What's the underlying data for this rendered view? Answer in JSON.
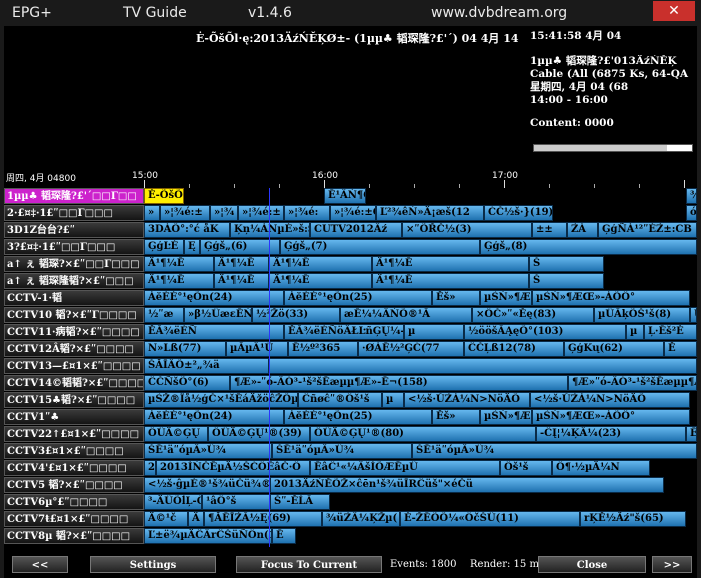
{
  "titlebar": {
    "app_name": "EPG+",
    "view": "TV Guide",
    "version": "v1.4.6",
    "website": "www.dvbdream.org",
    "close_glyph": "✕"
  },
  "info": {
    "description": "Ė-ÕšÕl·ę:2013ÄźŃĚĶØ±- (1µµ♣ 韬琛隆?£'´) 04 4月 14",
    "clock": "15:41:58  4月 04",
    "channel_name": "1µµ♣ 韬琛隆?£'013ÄźŃĚĶ",
    "cable": "Cable (All (6875 Ks, 64-QA",
    "weekday_date": "星期四, 4月 04 (68",
    "time_range": "14:00 - 16:00",
    "content_label": "Content: 0000",
    "progress_fraction": 0.84
  },
  "timeline": {
    "date_label": "周四, 4月 04800",
    "ticks": [
      "15:00",
      "16:00",
      "17:00"
    ]
  },
  "channels": [
    {
      "name": "1µµ♣ 韬琛隆?£'´□□Γ□□",
      "selected": true,
      "programs": [
        {
          "title": "Ė-ÕšÕl·ę:2013ÄźŃĚĶØ±-",
          "now": true
        },
        {
          "title": "Ē¹ÂŃ¶Ô≥¹:2010ÄźÂŃÌRÖ°NµŃ²»ÚČü"
        },
        {
          "title": "¾"
        }
      ]
    },
    {
      "name": "2·£¤‡·1£ʺ□□Γ□□□",
      "programs": [
        {
          "title": "»"
        },
        {
          "title": "»¦¾é:±"
        },
        {
          "title": "»¦¾"
        },
        {
          "title": "»¦¾é:±"
        },
        {
          "title": "»¦¾é:"
        },
        {
          "title": "»¦¾é:±GĀ"
        },
        {
          "title": "Ľ²¾êŃ»Ä¡æš(12"
        },
        {
          "title": "ĆČ½š·}(19)"
        },
        {
          "title": "ó"
        }
      ]
    },
    {
      "name": "3D1Z台台?£ʺ",
      "programs": [
        {
          "title": "3DÁÕ°:°ć åK"
        },
        {
          "title": "Ķņ¼ÀNµÉ»š:Š"
        },
        {
          "title": "CUTV2012Âź"
        },
        {
          "title": "×ʺÕŘČ½(3)"
        },
        {
          "title": "±±"
        },
        {
          "title": "ŹÁ"
        },
        {
          "title": "ĢģÑÁ¹²ʺÉŹ±:CB"
        }
      ]
    },
    {
      "name": "3?£¤‡·1£ʺ□□Γ□□□",
      "programs": [
        {
          "title": "ĢģĿÉ"
        },
        {
          "title": "Ę"
        },
        {
          "title": "Ģģš„(6)"
        },
        {
          "title": "Ģģš„(7)"
        },
        {
          "title": "Ģģš„(8)"
        }
      ]
    },
    {
      "name": "a↑ ぇ 韬琛?×£ʺ□□Γ□□□",
      "programs": [
        {
          "title": "Ä¹¶¼Ē"
        },
        {
          "title": "Ä¹¶¼Ē"
        },
        {
          "title": "Ä¹¶¼Ē"
        },
        {
          "title": "Ä¹¶¼Ē"
        },
        {
          "title": "Š"
        }
      ]
    },
    {
      "name": "a↑ ぇ 韬琛隆韬?×£ʺ□□□",
      "programs": [
        {
          "title": "Ä¹¶¼Ē"
        },
        {
          "title": "Ä¹¶¼Ē"
        },
        {
          "title": "Ä¹¶¼Ē"
        },
        {
          "title": "Ä¹¶¼Ē"
        },
        {
          "title": "Š"
        }
      ]
    },
    {
      "name": "CCTV-1·韬",
      "programs": [
        {
          "title": "ÀĕÈÉ°¹ęÕn(24)"
        },
        {
          "title": "ÀĕÈÉ°¹ęÕn(25)"
        },
        {
          "title": "Ĕš»"
        },
        {
          "title": "µŚŃ»¶ÆŒ»-ÀÕÖ°"
        },
        {
          "title": "µŚŃ»¶ÆŒ»-ÀÕÖ°"
        }
      ]
    },
    {
      "name": "CCTV10 韬?×£ʺΓ□□□□",
      "programs": [
        {
          "title": "½ʺæ"
        },
        {
          "title": "»β½ÜæεĒŃŠ"
        },
        {
          "title": "½²Žö(33)"
        },
        {
          "title": "æĒ¼¼ÂŃÕ®¹Ā"
        },
        {
          "title": "×ÖČ»ʺ«Ěę(83)"
        },
        {
          "title": "µÜĀķÕŠ¹š(8)"
        },
        {
          "title": "Ù"
        }
      ]
    },
    {
      "name": "CCTV11·病韬?×£ʺ□□□□",
      "programs": [
        {
          "title": "ĔĀ¾ëÈÑ"
        },
        {
          "title": "ĔĀ¾ëÈÑöÂŁĿñĢŲ¼-(2)"
        },
        {
          "title": "µ"
        },
        {
          "title": "½ööšĀĄęÕ°(103)"
        },
        {
          "title": "µ"
        },
        {
          "title": "Ļ·Ēš²Ė"
        }
      ]
    },
    {
      "name": "CCTV12Â韬?×£ʺ□□□□",
      "programs": [
        {
          "title": "N»Lß(77)"
        },
        {
          "title": "µĀµÂ¹Ü"
        },
        {
          "title": "Ē½º²365"
        },
        {
          "title": "·ØÀĒ½²ĢĆ(77"
        },
        {
          "title": "ĈČĻß12(78)"
        },
        {
          "title": "ĢģKų(62)"
        },
        {
          "title": "Ĕ"
        }
      ]
    },
    {
      "name": "CCTV13—£¤1×£ʺ□□□□",
      "programs": [
        {
          "title": "ŠĂĪÂÕ±²„¾ä"
        },
        {
          "title": ""
        }
      ]
    },
    {
      "name": "CCTV14©韬韬?×£ʺ□□□□",
      "programs": [
        {
          "title": "ĈČÑšÕ°(6)"
        },
        {
          "title": "¶Æ»-ʺó-ÂÓ³-¹š²šĒæµµ¶Æ»-Ē¬(158)"
        },
        {
          "title": "¶Æ»ʺó-ÂÓ³-¹š²šĒæµµ¶Æ»"
        }
      ]
    },
    {
      "name": "CCTV15♣韬?×£ʺ□□□□",
      "programs": [
        {
          "title": "µŚŽ®Îå½ģČ×¹šĒáÄžöĉŽÕµë"
        },
        {
          "title": "Ĉñøĉʺ®Öš¹š"
        },
        {
          "title": "µ"
        },
        {
          "title": "<½š·ŬŹÀ¼N>NöÄÕ"
        },
        {
          "title": "<½š·ŬŹÀ¼N>NöÄÕ"
        }
      ]
    },
    {
      "name": "CCTV1ʺ♣",
      "programs": [
        {
          "title": "ÀĕÈÉ°¹ęÕn(24)"
        },
        {
          "title": "ÀĕÈÉ°¹ęÕn(25)"
        },
        {
          "title": "Ĕš»"
        },
        {
          "title": "µŚŃ»¶ÆŒ»-ÀÕÖ°"
        },
        {
          "title": "µŚŃ»¶ÆŒ»-ÀÕÖ°"
        }
      ]
    },
    {
      "name": "CCTV22↑£¤1×£ʺ□□□□",
      "programs": [
        {
          "title": "ÖÜÄ©ĢŲ"
        },
        {
          "title": "ÖÜÄ©ĢŲ¹®(39)"
        },
        {
          "title": "ÖÜÄ©ĢŲ¹®(80)"
        },
        {
          "title": "-ĈĮ¦¼ĶÂ¼(23)"
        },
        {
          "title": "Ē"
        }
      ]
    },
    {
      "name": "CCTV3£¤1×£ʺ□□□□",
      "programs": [
        {
          "title": "ŠĒ¹äʺóµÂ»Ü¾"
        },
        {
          "title": "ŠĒ¹äʺóµÂ»Ü¾"
        },
        {
          "title": "ŠĒ¹äʺóµÂ»Ü¾"
        }
      ]
    },
    {
      "name": "CCTV4'£¤1×£ʺ□□□□",
      "programs": [
        {
          "title": "2"
        },
        {
          "title": "2013ÍŃČĒµÄ½ŠĆÖĒâČ·Ö"
        },
        {
          "title": "ĒâĈ¹«¼ÂšÌÕÆĒµÜ"
        },
        {
          "title": "Öš¹š"
        },
        {
          "title": "Ö¶·½µÄ¼N"
        }
      ]
    },
    {
      "name": "CCTV5 韬?×£ʺ□□□□",
      "programs": [
        {
          "title": "<½š·ĝµÉ®¹š¾üČü¾®×ÖĖ×Ĉ"
        },
        {
          "title": "2013ÄźŃĚÕŽ×ĉēn¹š¾üĪRĈüš\"×éČü"
        }
      ]
    },
    {
      "name": "CCTV6µ°£ʺ□□□□",
      "programs": [
        {
          "title": "³-ÄÜÕĺĻ-Õß"
        },
        {
          "title": "¹âÖ°š"
        },
        {
          "title": "Šʺ-ĔĹĀ"
        }
      ]
    },
    {
      "name": "CCTV7ŧ£¤1×£ʺ□□□□",
      "programs": [
        {
          "title": "Ä©¹č"
        },
        {
          "title": "Ä"
        },
        {
          "title": "¶ĂĒĪŹĀ½Ę(69)"
        },
        {
          "title": "¾üŹÂ¼ĶŽµ("
        },
        {
          "title": "Ė-ŽĒÕÕ¼«ÖčŠÜ(11)"
        },
        {
          "title": "rĶĔ½Ãź\"š(65)"
        }
      ]
    },
    {
      "name": "CCTV8µ 韬?×£ʺ□□□□",
      "programs": [
        {
          "title": "Ľ±ë¾µÄĈÂrĈŠüÑÖn(18)"
        },
        {
          "title": "Ē"
        }
      ]
    }
  ],
  "bottom": {
    "prev_label": "<<",
    "settings_label": "Settings",
    "focus_label": "Focus To Current",
    "events_label": "Events: 1800",
    "render_label": "Render: 15 ms",
    "close_label": "Close",
    "next_label": ">>"
  },
  "colors": {
    "program_blue": "#2a7dba",
    "now_yellow": "#ffee00",
    "selected_channel": "#cc22cc",
    "now_line": "#2a36ff"
  }
}
